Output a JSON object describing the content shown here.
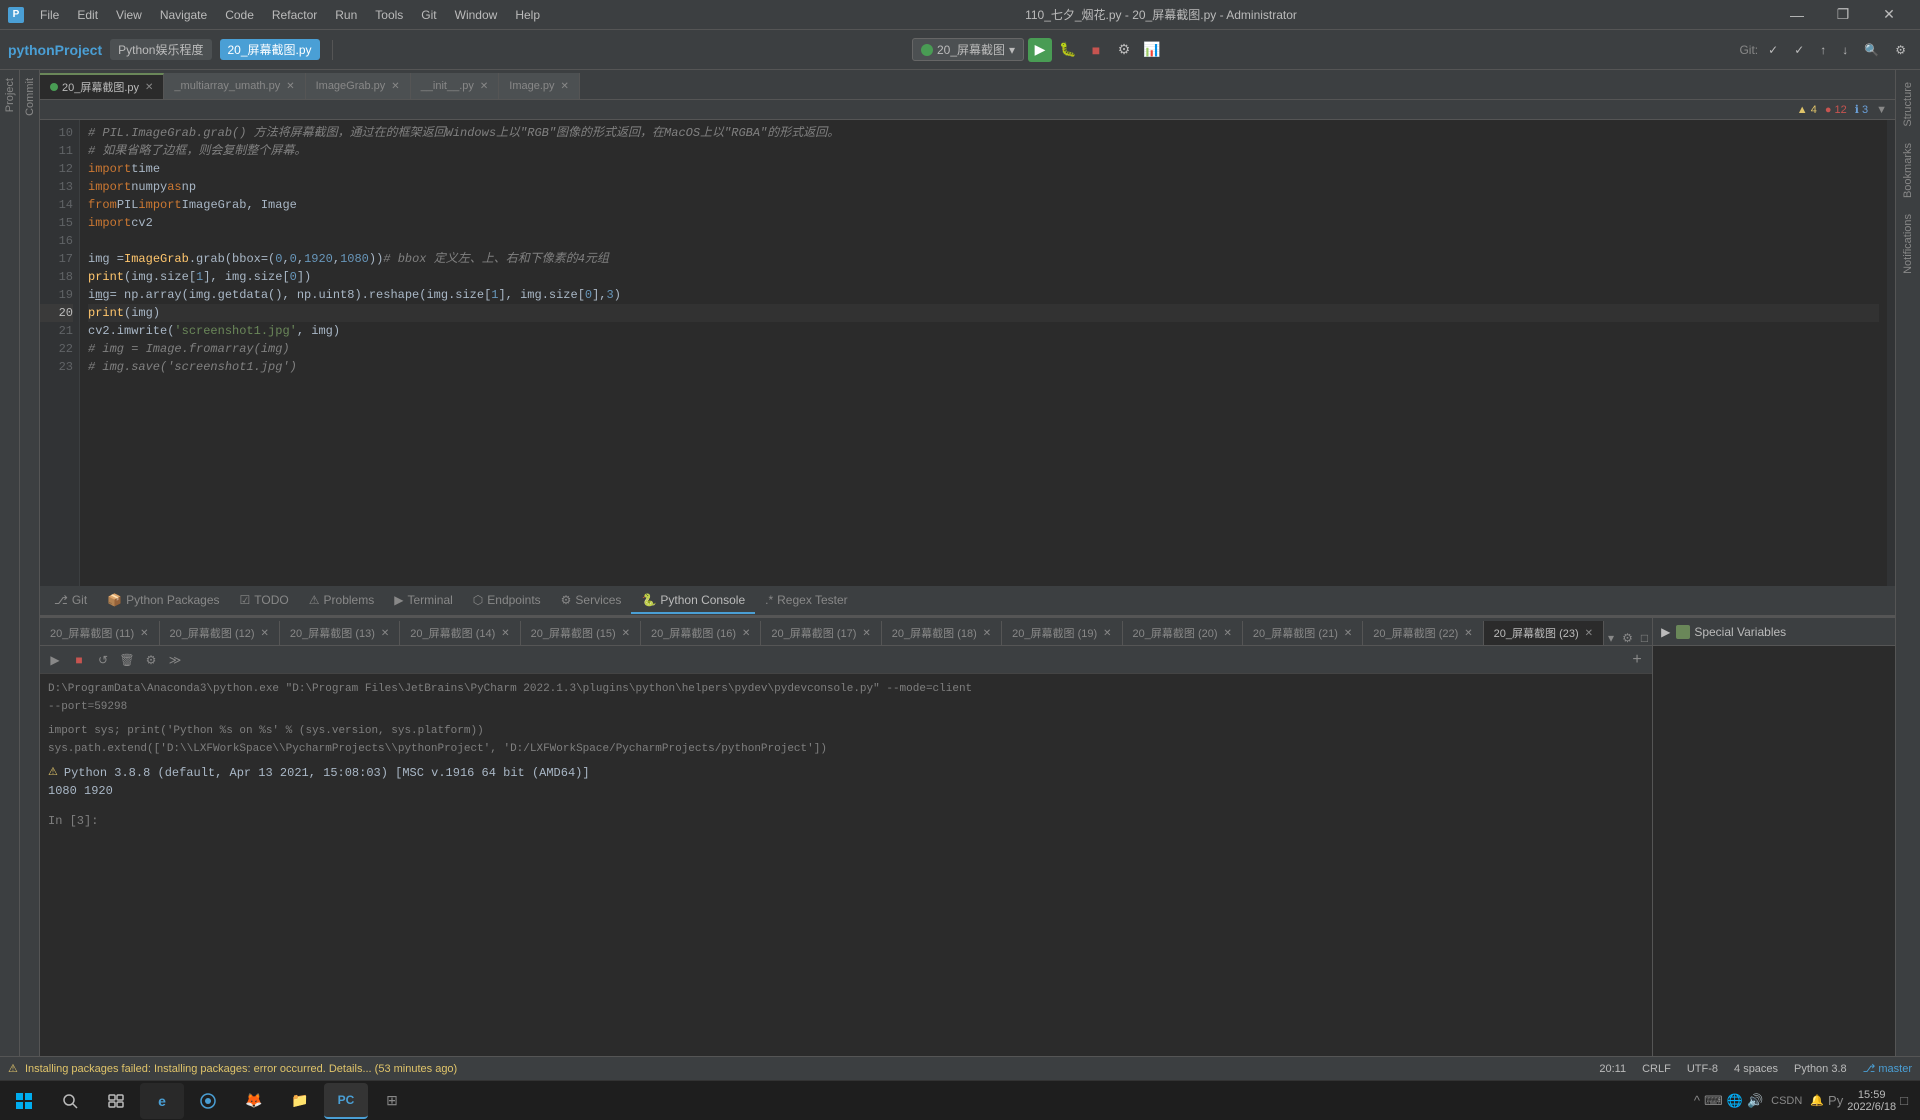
{
  "titlebar": {
    "title": "110_七夕_烟花.py - 20_屏幕截图.py - Administrator",
    "menu_items": [
      "File",
      "Edit",
      "View",
      "Navigate",
      "Code",
      "Refactor",
      "Run",
      "Tools",
      "Git",
      "Window",
      "Help"
    ],
    "minimize": "—",
    "restore": "❐",
    "close": "✕"
  },
  "project": {
    "name": "pythonProject",
    "tab_label": "Python娱乐程度",
    "active_file": "20_屏幕截图.py"
  },
  "toolbar": {
    "run_config": "20_屏幕截图",
    "git_label": "Git:"
  },
  "file_tabs": [
    {
      "label": "20_屏幕截图.py",
      "active": true
    },
    {
      "label": "_multiarray_umath.py",
      "active": false
    },
    {
      "label": "ImageGrab.py",
      "active": false
    },
    {
      "label": "__init__.py",
      "active": false
    },
    {
      "label": "Image.py",
      "active": false
    }
  ],
  "warning_bar": {
    "warnings": "▲ 4",
    "errors": "● 12",
    "info": "ℹ 3"
  },
  "code_lines": [
    {
      "num": "10",
      "content": "# PIL.ImageGrab.grab() 方法将屏幕截图，通过在的框架返回Windows上以\"RGB\"图像的形式返回，在MacOS上以\"RGBA\"的形式返回。"
    },
    {
      "num": "11",
      "content": "# 如果省略了边框，则会复制整个屏幕。"
    },
    {
      "num": "12",
      "content": "import time"
    },
    {
      "num": "13",
      "content": "import numpy as np"
    },
    {
      "num": "14",
      "content": "from PIL import ImageGrab, Image"
    },
    {
      "num": "15",
      "content": "import cv2"
    },
    {
      "num": "16",
      "content": ""
    },
    {
      "num": "17",
      "content": "img = ImageGrab.grab(bbox=(0, 0, 1920, 1080))  # bbox 定义左、上、右和下像素的4元组"
    },
    {
      "num": "18",
      "content": "print(img.size[1], img.size[0])"
    },
    {
      "num": "19",
      "content": "img = np.array(img.getdata(), np.uint8).reshape(img.size[1], img.size[0], 3)"
    },
    {
      "num": "20",
      "content": "print(img)"
    },
    {
      "num": "21",
      "content": "cv2.imwrite('screenshot1.jpg', img)"
    },
    {
      "num": "22",
      "content": "# img = Image.fromarray(img)"
    },
    {
      "num": "23",
      "content": "# img.save('screenshot1.jpg')"
    }
  ],
  "console_tabs": [
    {
      "label": "20_屏幕截图 (11)"
    },
    {
      "label": "20_屏幕截图 (12)"
    },
    {
      "label": "20_屏幕截图 (13)"
    },
    {
      "label": "20_屏幕截图 (14)"
    },
    {
      "label": "20_屏幕截图 (15)"
    },
    {
      "label": "20_屏幕截图 (16)"
    },
    {
      "label": "20_屏幕截图 (17)"
    },
    {
      "label": "20_屏幕截图 (18)"
    },
    {
      "label": "20_屏幕截图 (19)"
    },
    {
      "label": "20_屏幕截图 (20)"
    },
    {
      "label": "20_屏幕截图 (21)"
    },
    {
      "label": "20_屏幕截图 (22)"
    },
    {
      "label": "20_屏幕截图 (23)",
      "active": true
    }
  ],
  "console_output": {
    "cmd1": "D:\\ProgramData\\Anaconda3\\python.exe \"D:\\Program Files\\JetBrains\\PyCharm 2022.1.3\\plugins\\python\\helpers\\pydev\\pydevconsole.py\" --mode=client",
    "cmd2": "--port=59298",
    "import_cmd": "import sys; print('Python %s on %s' % (sys.version, sys.platform))",
    "path_cmd": "sys.path.extend(['D:\\\\LXFWorkSpace\\\\PycharmProjects\\\\pythonProject', 'D:/LXFWorkSpace/PycharmProjects/pythonProject'])",
    "python_version": "Python 3.8.8 (default, Apr 13 2021, 15:08:03) [MSC v.1916 64 bit (AMD64)]",
    "output_1080": "1080 1920",
    "prompt": "In [3]:"
  },
  "vars_panel": {
    "title": "Special Variables"
  },
  "bottom_tabs": [
    {
      "label": "Git",
      "icon": "git"
    },
    {
      "label": "Python Packages",
      "icon": "package"
    },
    {
      "label": "TODO",
      "icon": "todo"
    },
    {
      "label": "Problems",
      "icon": "problems"
    },
    {
      "label": "Terminal",
      "icon": "terminal"
    },
    {
      "label": "Endpoints",
      "icon": "endpoints"
    },
    {
      "label": "Services",
      "icon": "services"
    },
    {
      "label": "Python Console",
      "icon": "console",
      "active": true
    },
    {
      "label": "Regex Tester",
      "icon": "regex"
    }
  ],
  "statusbar": {
    "install_msg": "Installing packages failed: Installing packages: error occurred. Details... (53 minutes ago)",
    "position": "20:11",
    "crlf": "CRLF",
    "encoding": "UTF-8",
    "spaces": "4 spaces",
    "python": "Python 3.8",
    "vcs": "master"
  },
  "taskbar": {
    "time": "15:59",
    "date": "2022/6/18"
  }
}
